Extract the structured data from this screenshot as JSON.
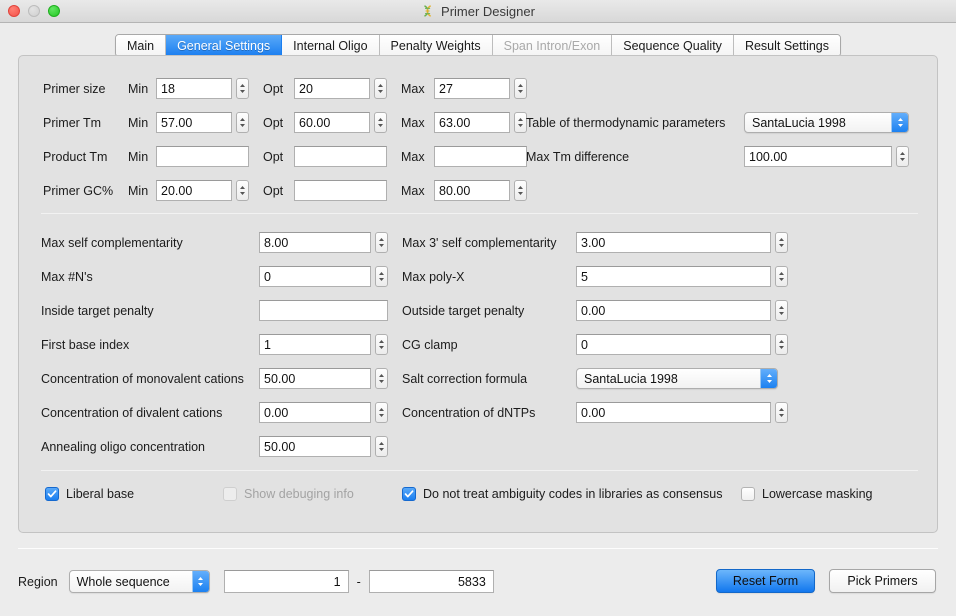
{
  "window": {
    "title": "Primer Designer",
    "app_icon": "dna-helix-icon",
    "controls": [
      "close",
      "minimize",
      "zoom"
    ]
  },
  "tabs": [
    {
      "label": "Main",
      "state": "normal"
    },
    {
      "label": "General Settings",
      "state": "active"
    },
    {
      "label": "Internal Oligo",
      "state": "normal"
    },
    {
      "label": "Penalty Weights",
      "state": "normal"
    },
    {
      "label": "Span Intron/Exon",
      "state": "disabled"
    },
    {
      "label": "Sequence Quality",
      "state": "normal"
    },
    {
      "label": "Result Settings",
      "state": "normal"
    }
  ],
  "section_ranges": {
    "col_labels": {
      "min": "Min",
      "opt": "Opt",
      "max": "Max"
    },
    "rows": [
      {
        "label": "Primer size",
        "min": "18",
        "opt": "20",
        "max": "27",
        "stepper": true
      },
      {
        "label": "Primer Tm",
        "min": "57.00",
        "opt": "60.00",
        "max": "63.00",
        "stepper": true
      },
      {
        "label": "Product Tm",
        "min": "",
        "opt": "",
        "max": "",
        "stepper": false
      },
      {
        "label": "Primer GC%",
        "min": "20.00",
        "opt": "",
        "max": "80.00",
        "stepper": true
      }
    ],
    "thermo_table": {
      "label": "Table of thermodynamic parameters",
      "value": "SantaLucia 1998"
    },
    "max_tm_difference": {
      "label": "Max Tm difference",
      "value": "100.00"
    }
  },
  "section_params": {
    "left": [
      {
        "label": "Max self complementarity",
        "value": "8.00",
        "stepper": true
      },
      {
        "label": "Max #N's",
        "value": "0",
        "stepper": true
      },
      {
        "label": "Inside target penalty",
        "value": "",
        "stepper": false
      },
      {
        "label": "First base index",
        "value": "1",
        "stepper": true
      },
      {
        "label": "Concentration of monovalent cations",
        "value": "50.00",
        "stepper": true
      },
      {
        "label": "Concentration of divalent cations",
        "value": "0.00",
        "stepper": true
      },
      {
        "label": "Annealing oligo concentration",
        "value": "50.00",
        "stepper": true
      }
    ],
    "right": [
      {
        "label": "Max 3' self complementarity",
        "value": "3.00",
        "stepper": true,
        "type": "field"
      },
      {
        "label": "Max poly-X",
        "value": "5",
        "stepper": true,
        "type": "field"
      },
      {
        "label": "Outside target penalty",
        "value": "0.00",
        "stepper": true,
        "type": "field"
      },
      {
        "label": "CG clamp",
        "value": "0",
        "stepper": true,
        "type": "field"
      },
      {
        "label": "Salt correction formula",
        "value": "SantaLucia 1998",
        "stepper": false,
        "type": "popup"
      },
      {
        "label": "Concentration of dNTPs",
        "value": "0.00",
        "stepper": true,
        "type": "field"
      }
    ]
  },
  "checkboxes": [
    {
      "label": "Liberal base",
      "checked": true,
      "disabled": false
    },
    {
      "label": "Show debuging info",
      "checked": false,
      "disabled": true
    },
    {
      "label": "Do not treat ambiguity codes in libraries as consensus",
      "checked": true,
      "disabled": false
    },
    {
      "label": "Lowercase masking",
      "checked": false,
      "disabled": false
    }
  ],
  "bottom": {
    "region_label": "Region",
    "region_value": "Whole sequence",
    "range_start": "1",
    "range_dash": "-",
    "range_end": "5833",
    "reset_button": "Reset Form",
    "pick_button": "Pick Primers"
  }
}
